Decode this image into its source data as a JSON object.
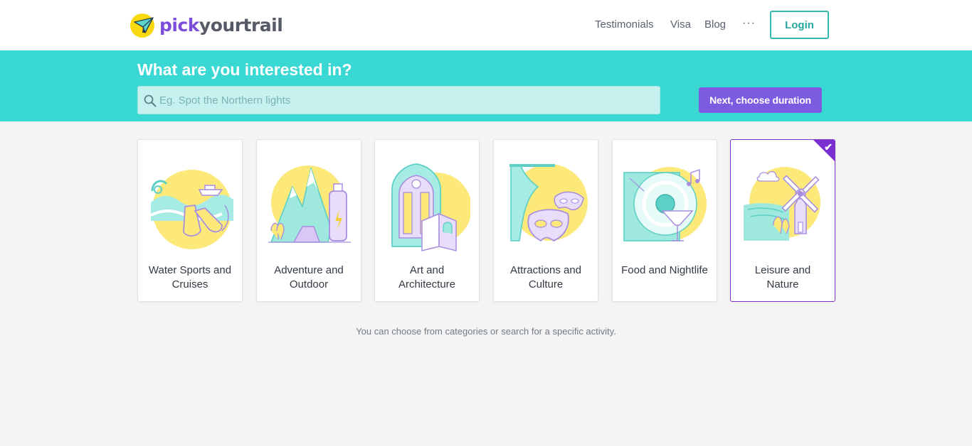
{
  "brand": {
    "name_part1": "pick",
    "name_part2": "yourtrail"
  },
  "nav": {
    "testimonials": "Testimonials",
    "visa": "Visa",
    "blog": "Blog",
    "more": "···",
    "login": "Login"
  },
  "hero": {
    "title": "What are you interested in?",
    "search_placeholder": "Eg. Spot the Northern lights",
    "next_button": "Next, choose duration"
  },
  "categories": [
    {
      "label": "Water Sports and Cruises",
      "icon": "water-sports-illustration",
      "selected": false
    },
    {
      "label": "Adventure and Outdoor",
      "icon": "adventure-illustration",
      "selected": false
    },
    {
      "label": "Art and Architecture",
      "icon": "architecture-illustration",
      "selected": false
    },
    {
      "label": "Attractions and Culture",
      "icon": "culture-illustration",
      "selected": false
    },
    {
      "label": "Food and Nightlife",
      "icon": "nightlife-illustration",
      "selected": false
    },
    {
      "label": "Leisure and Nature",
      "icon": "nature-illustration",
      "selected": true
    }
  ],
  "hint": "You can choose from categories or search for a specific activity.",
  "colors": {
    "teal": "#3ad8d3",
    "purple": "#7c5be0",
    "selected_border": "#7b35c9",
    "yellow": "#fce97a",
    "mint": "#9ee8de",
    "lavender": "#d9c8f5"
  }
}
